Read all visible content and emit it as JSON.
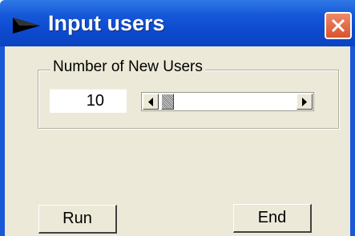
{
  "window": {
    "title": "Input users",
    "title_icon": "arrow-right-icon",
    "close_icon": "close-icon",
    "colors": {
      "titlebar": "#0c49cc",
      "close": "#d9532b",
      "client": "#ece9d8"
    }
  },
  "group": {
    "label": "Number of New Users",
    "value": "10",
    "slider": {
      "level_fraction": 0.05,
      "left_icon": "scroll-left-icon",
      "right_icon": "scroll-right-icon"
    }
  },
  "buttons": {
    "run_label": "Run",
    "end_label": "End"
  }
}
